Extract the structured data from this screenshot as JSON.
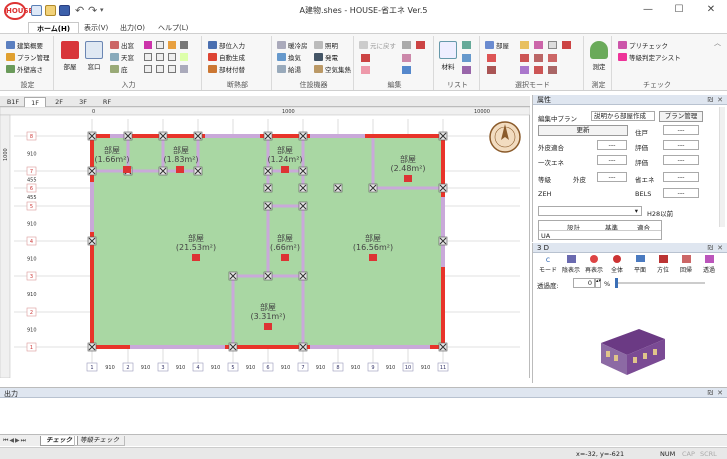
{
  "window": {
    "title": "A建物.shes - HOUSE-省エネ Ver.5",
    "app_icon_text": "HOUSE",
    "minimize": "—",
    "maximize": "☐",
    "close": "✕"
  },
  "ribbon_tabs": [
    {
      "label": "ホーム(H)",
      "active": true
    },
    {
      "label": "表示(V)"
    },
    {
      "label": "出力(O)"
    },
    {
      "label": "ヘルプ(L)"
    }
  ],
  "ribbon_groups": {
    "settings": {
      "label": "設定",
      "items": [
        "建築概要",
        "プラン管理",
        "外壁高さ"
      ]
    },
    "input": {
      "label": "入力",
      "big": [
        "部屋",
        "窓口"
      ],
      "items": [
        "出窓",
        "天窓",
        "庇"
      ]
    },
    "insulation": {
      "label": "断熱部",
      "items": [
        "部位入力",
        "自動生成",
        "部材付替"
      ]
    },
    "equipment": {
      "label": "住設機器",
      "items": [
        "暖冷房",
        "換気",
        "給湯",
        "照明",
        "発電",
        "空気集熱"
      ]
    },
    "edit": {
      "label": "編集",
      "items": [
        "元に戻す"
      ]
    },
    "list": {
      "label": "リスト",
      "big": [
        "材料"
      ]
    },
    "select_mode": {
      "label": "選択モード",
      "items": [
        "部屋"
      ]
    },
    "measure": {
      "label": "測定",
      "big": [
        "測定"
      ]
    },
    "check": {
      "label": "チェック",
      "items": [
        "プリチェック",
        "等級判定アシスト"
      ]
    }
  },
  "floor_tabs": [
    {
      "label": "B1F"
    },
    {
      "label": "1F",
      "active": true
    },
    {
      "label": "2F"
    },
    {
      "label": "3F"
    },
    {
      "label": "RF"
    }
  ],
  "ruler": {
    "top_marks": [
      "0",
      "1000",
      "10000"
    ],
    "left_mark": "1000"
  },
  "grid_left": [
    {
      "num": "8",
      "dim": "910"
    },
    {
      "num": "7",
      "dim": "455"
    },
    {
      "num": "6",
      "dim": "455"
    },
    {
      "num": "5",
      "dim": "910"
    },
    {
      "num": "4",
      "dim": "910"
    },
    {
      "num": "3",
      "dim": "910"
    },
    {
      "num": "2",
      "dim": "910"
    },
    {
      "num": "1",
      "dim": ""
    }
  ],
  "grid_bottom": [
    {
      "num": "1",
      "dim": "910"
    },
    {
      "num": "2",
      "dim": "910"
    },
    {
      "num": "3",
      "dim": "910"
    },
    {
      "num": "4",
      "dim": "910"
    },
    {
      "num": "5",
      "dim": "910"
    },
    {
      "num": "6",
      "dim": "910"
    },
    {
      "num": "7",
      "dim": "910"
    },
    {
      "num": "8",
      "dim": "910"
    },
    {
      "num": "9",
      "dim": "910"
    },
    {
      "num": "10",
      "dim": "910"
    },
    {
      "num": "11",
      "dim": ""
    }
  ],
  "rooms": [
    {
      "name": "部屋",
      "area": "(1.66m²)"
    },
    {
      "name": "部屋",
      "area": "(1.83m²)"
    },
    {
      "name": "部屋",
      "area": "(1.24m²)"
    },
    {
      "name": "部屋",
      "area": "(2.48m²)"
    },
    {
      "name": "部屋",
      "area": "(21.53m²)"
    },
    {
      "name": "部屋",
      "area": "(.66m²)"
    },
    {
      "name": "部屋",
      "area": "(16.56m²)"
    },
    {
      "name": "部屋",
      "area": "(3.31m²)"
    }
  ],
  "properties": {
    "title": "属性",
    "edit_plan_label": "編集中プラン",
    "edit_plan_value": "説明から部屋作成",
    "plan_manage_btn": "プラン管理",
    "update_btn": "更新",
    "rows": [
      {
        "l1": "",
        "v1": "",
        "l2": "住戸",
        "v2": "---"
      },
      {
        "l1": "外皮適合",
        "v1": "---",
        "l2": "評価",
        "v2": "---"
      },
      {
        "l1": "一次エネ",
        "v1": "---",
        "l2": "評価",
        "v2": "---"
      },
      {
        "l1": "等級",
        "sub": "外皮",
        "v1": "---",
        "l2": "省エネ",
        "v2": "---"
      },
      {
        "l1": "ZEH",
        "v1": "",
        "l2": "BELS",
        "v2": "---"
      }
    ],
    "h28_label": "H28以前",
    "table_headers": [
      "設計",
      "基準",
      "適合"
    ],
    "table_row_label": "UA"
  },
  "panel3d": {
    "title": "3 D",
    "toolbar": [
      "モード",
      "陰表示",
      "再表示",
      "全体",
      "平面",
      "方位",
      "回帰",
      "透過"
    ],
    "transparency_label": "透過度:",
    "transparency_value": "0",
    "transparency_unit": "%"
  },
  "output": {
    "title": "出力"
  },
  "bottom_tabs": [
    {
      "label": "チェック",
      "active": true
    },
    {
      "label": "等級チェック"
    }
  ],
  "status": {
    "coords": "x=-32, y=-621",
    "num": "NUM",
    "cap": "CAP",
    "scrl": "SCRL"
  },
  "colors": {
    "room_fill": "#a9d7a3",
    "outer_wall": "#e8342a",
    "inner_wall": "#c9a9d9",
    "node": "#8a8a8a",
    "accent": "#3b6fb6"
  }
}
